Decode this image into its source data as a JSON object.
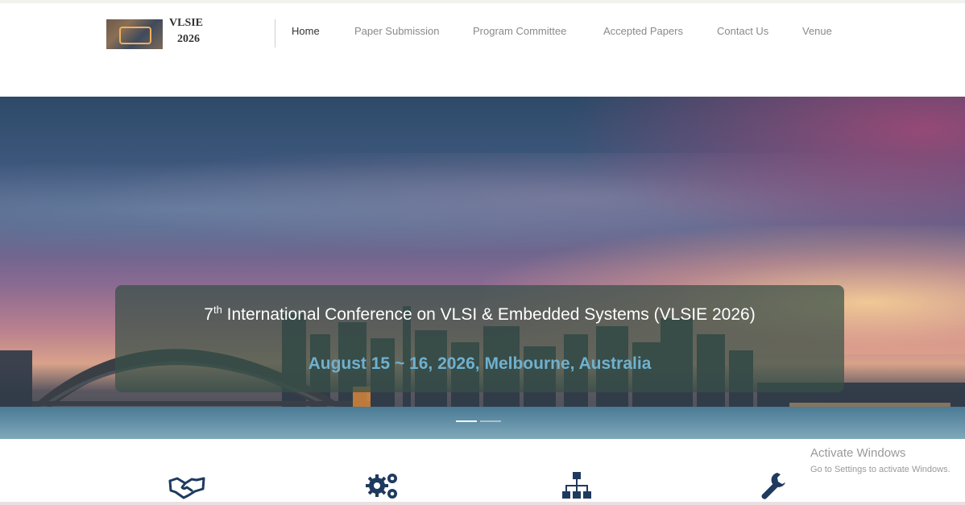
{
  "site": {
    "logo_line1": "VLSIE",
    "logo_line2": "2026"
  },
  "nav": {
    "items": [
      {
        "label": "Home",
        "active": true
      },
      {
        "label": "Paper Submission",
        "active": false
      },
      {
        "label": "Program Committee",
        "active": false
      },
      {
        "label": "Accepted Papers",
        "active": false
      },
      {
        "label": "Contact Us",
        "active": false
      },
      {
        "label": "Venue",
        "active": false
      }
    ]
  },
  "hero": {
    "ordinal_number": "7",
    "ordinal_suffix": "th",
    "title_rest": " International Conference on VLSI & Embedded Systems (VLSIE 2026)",
    "date_location": "August 15 ~ 16, 2026, Melbourne, Australia",
    "slide_count": 2,
    "active_slide": 1
  },
  "features": {
    "icons": [
      "handshake-icon",
      "gears-icon",
      "sitemap-icon",
      "wrench-icon"
    ]
  },
  "watermark": {
    "title": "Activate Windows",
    "subtitle": "Go to Settings to activate Windows."
  },
  "colors": {
    "banner_date": "#6fb1cf",
    "icon_navy": "#1f3a5f",
    "nav_active": "#333333",
    "nav_inactive": "#8a8a8a"
  }
}
